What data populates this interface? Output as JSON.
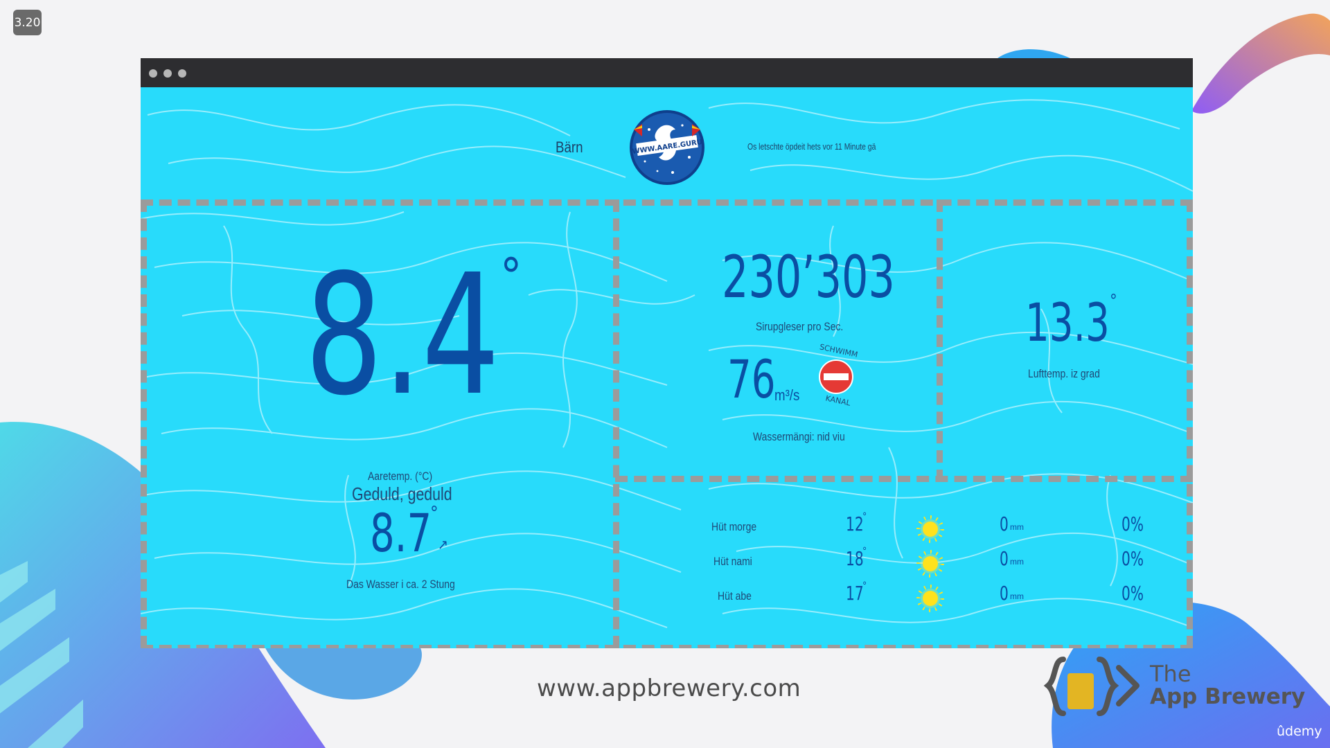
{
  "slide": {
    "number": "3.20"
  },
  "header": {
    "city": "Bärn",
    "logo_text": "WWW.AARE.GURU",
    "update_note": "Os letschte öpdeit hets vor 11 Minute gä"
  },
  "water_temp": {
    "value": "8.4",
    "degree": "°",
    "label": "Aaretemp. (°C)",
    "comment": "Geduld, geduld",
    "forecast_value": "8.7",
    "forecast_degree": "°",
    "forecast_arrow": "↗",
    "forecast_label": "Das Wasser i ca. 2 Stung"
  },
  "flow": {
    "sirup_value": "230’303",
    "sirup_label": "Sirupgleser pro Sec.",
    "volume_value": "76",
    "volume_unit": "m³/s",
    "badge_top": "SCHWIMM",
    "badge_bottom": "KANAL",
    "volume_label": "Wassermängi: nid viu"
  },
  "air": {
    "value": "13.3",
    "degree": "°",
    "label": "Lufttemp. iz grad"
  },
  "forecast": {
    "rows": [
      {
        "time": "Hüt morge",
        "temp": "12",
        "deg": "°",
        "icon": "sun-icon",
        "rain": "0",
        "rain_unit": "mm",
        "chance": "0%"
      },
      {
        "time": "Hüt nami",
        "temp": "18",
        "deg": "°",
        "icon": "sun-icon",
        "rain": "0",
        "rain_unit": "mm",
        "chance": "0%"
      },
      {
        "time": "Hüt abe",
        "temp": "17",
        "deg": "°",
        "icon": "sun-icon",
        "rain": "0",
        "rain_unit": "mm",
        "chance": "0%"
      }
    ]
  },
  "footer": {
    "url": "www.appbrewery.com",
    "brand_the": "The",
    "brand_name": "App Brewery",
    "udemy": "ûdemy"
  },
  "colors": {
    "water": "#28dbfb",
    "text_blue": "#0a4ea3",
    "dash": "#9b9b9b",
    "titlebar": "#2d2d30",
    "sun": "#ffe21c",
    "no_entry": "#e53935"
  }
}
